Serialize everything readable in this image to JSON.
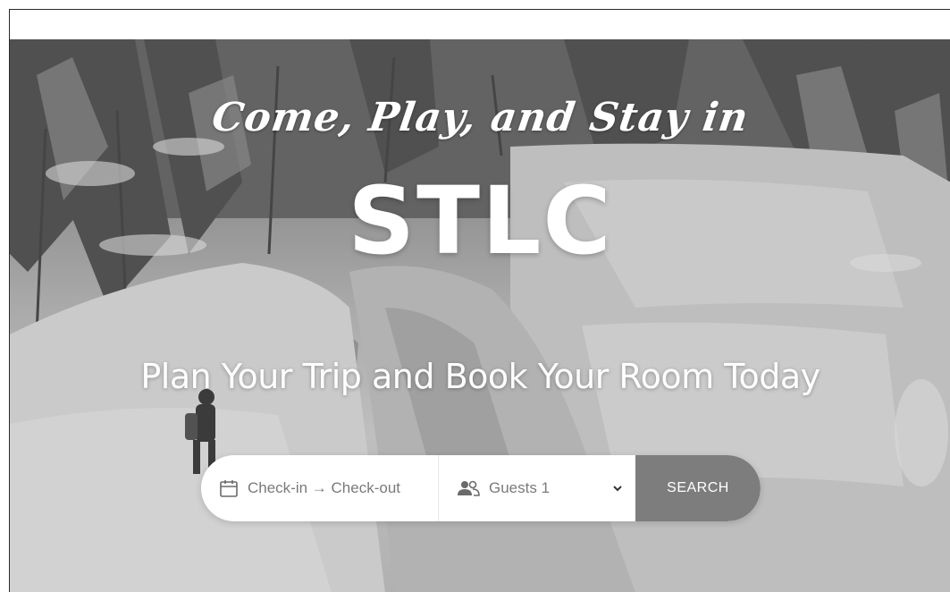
{
  "hero": {
    "tagline": "Come, Play, and Stay in",
    "brand": "STLC",
    "subtitle": "Plan Your Trip and Book Your Room Today"
  },
  "search": {
    "dates_label": "Check-in → Check-out",
    "guests_label": "Guests 1",
    "button_label": "SEARCH"
  },
  "icons": {
    "dates": "calendar-icon",
    "guests": "people-icon",
    "dropdown": "chevron-down-icon"
  },
  "colors": {
    "button": "#7d7d7d",
    "text_muted": "#7a7a7a",
    "hero_text": "#ffffff"
  }
}
